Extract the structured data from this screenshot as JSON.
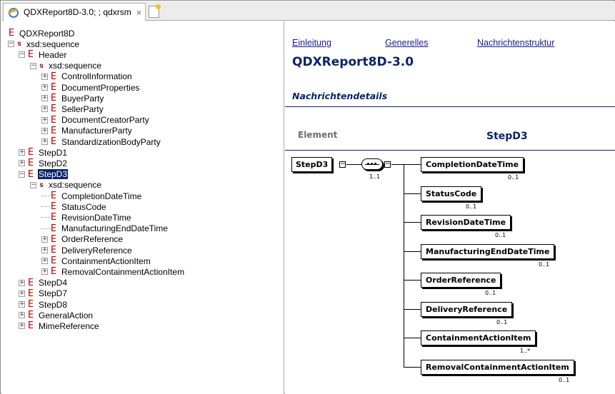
{
  "tab": {
    "title": "QDXReport8D-3.0; ; qdxrsm",
    "close": "×"
  },
  "tree": {
    "root": "QDXReport8D",
    "rows": [
      {
        "label": "QDXReport8D",
        "kind": "E",
        "level": 0,
        "exp": ""
      },
      {
        "label": "xsd:sequence",
        "kind": "s",
        "level": 0,
        "exp": "-"
      },
      {
        "label": "Header",
        "kind": "E",
        "level": 1,
        "exp": "-"
      },
      {
        "label": "xsd:sequence",
        "kind": "s",
        "level": 2,
        "exp": "-"
      },
      {
        "label": "ControlInformation",
        "kind": "E",
        "level": 3,
        "exp": "+"
      },
      {
        "label": "DocumentProperties",
        "kind": "E",
        "level": 3,
        "exp": "+"
      },
      {
        "label": "BuyerParty",
        "kind": "E",
        "level": 3,
        "exp": "+"
      },
      {
        "label": "SellerParty",
        "kind": "E",
        "level": 3,
        "exp": "+"
      },
      {
        "label": "DocumentCreatorParty",
        "kind": "E",
        "level": 3,
        "exp": "+"
      },
      {
        "label": "ManufacturerParty",
        "kind": "E",
        "level": 3,
        "exp": "+"
      },
      {
        "label": "StandardizationBodyParty",
        "kind": "E",
        "level": 3,
        "exp": "+"
      },
      {
        "label": "StepD1",
        "kind": "E",
        "level": 1,
        "exp": "+"
      },
      {
        "label": "StepD2",
        "kind": "E",
        "level": 1,
        "exp": "+"
      },
      {
        "label": "StepD3",
        "kind": "E",
        "level": 1,
        "exp": "-",
        "selected": true
      },
      {
        "label": "xsd:sequence",
        "kind": "s",
        "level": 2,
        "exp": "-"
      },
      {
        "label": "CompletionDateTime",
        "kind": "E",
        "level": 3,
        "exp": ""
      },
      {
        "label": "StatusCode",
        "kind": "E",
        "level": 3,
        "exp": ""
      },
      {
        "label": "RevisionDateTime",
        "kind": "E",
        "level": 3,
        "exp": ""
      },
      {
        "label": "ManufacturingEndDateTime",
        "kind": "E",
        "level": 3,
        "exp": ""
      },
      {
        "label": "OrderReference",
        "kind": "E",
        "level": 3,
        "exp": "+"
      },
      {
        "label": "DeliveryReference",
        "kind": "E",
        "level": 3,
        "exp": "+"
      },
      {
        "label": "ContainmentActionItem",
        "kind": "E",
        "level": 3,
        "exp": "+"
      },
      {
        "label": "RemovalContainmentActionItem",
        "kind": "E",
        "level": 3,
        "exp": "+"
      },
      {
        "label": "StepD4",
        "kind": "E",
        "level": 1,
        "exp": "+"
      },
      {
        "label": "StepD7",
        "kind": "E",
        "level": 1,
        "exp": "+"
      },
      {
        "label": "StepD8",
        "kind": "E",
        "level": 1,
        "exp": "+"
      },
      {
        "label": "GeneralAction",
        "kind": "E",
        "level": 1,
        "exp": "+"
      },
      {
        "label": "MimeReference",
        "kind": "E",
        "level": 1,
        "exp": "+"
      }
    ]
  },
  "doc": {
    "nav": [
      "Einleitung",
      "Generelles",
      "Nachrichtenstruktur"
    ],
    "title": "QDXReport8D-3.0",
    "section": "Nachrichtendetails",
    "element_label": "Element",
    "element_name": "StepD3"
  },
  "diagram": {
    "root": "StepD3",
    "sequence_occurrence": "1..1",
    "children": [
      {
        "name": "CompletionDateTime",
        "occurrence": "0..1"
      },
      {
        "name": "StatusCode",
        "occurrence": "0..1"
      },
      {
        "name": "RevisionDateTime",
        "occurrence": "0..1"
      },
      {
        "name": "ManufacturingEndDateTime",
        "occurrence": "0..1"
      },
      {
        "name": "OrderReference",
        "occurrence": "0..1"
      },
      {
        "name": "DeliveryReference",
        "occurrence": "0..1"
      },
      {
        "name": "ContainmentActionItem",
        "occurrence": "1..*"
      },
      {
        "name": "RemovalContainmentActionItem",
        "occurrence": "0..1"
      }
    ]
  },
  "colors": {
    "element_icon": "#c00000",
    "heading": "#0a246a",
    "link": "#1a1a8c",
    "selection": "#0a246a"
  }
}
